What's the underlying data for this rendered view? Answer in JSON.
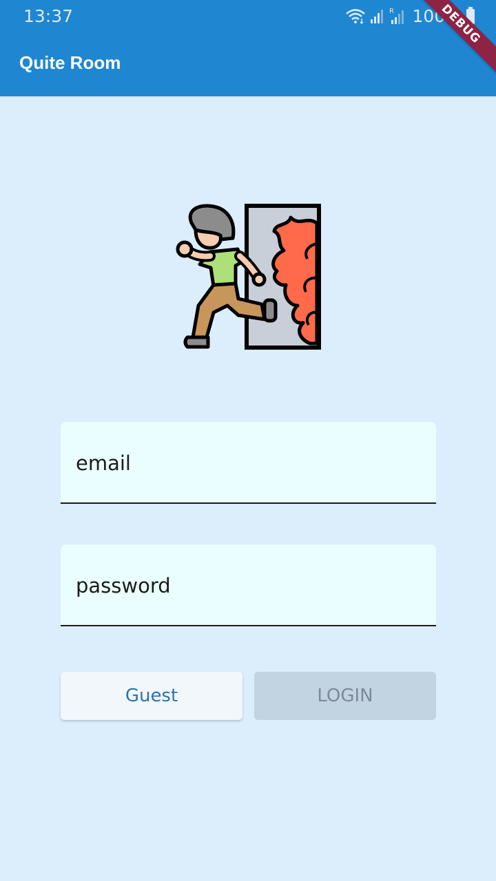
{
  "status_bar": {
    "time": "13:37",
    "battery": "100%",
    "icons": [
      "wifi-icon",
      "signal-icon",
      "signal-roaming-icon",
      "battery-icon"
    ]
  },
  "app_bar": {
    "title": "Quite Room",
    "debug_banner": "DEBUG"
  },
  "hero": {
    "icon": "running-from-fire-icon"
  },
  "form": {
    "email": {
      "placeholder": "email",
      "value": ""
    },
    "password": {
      "placeholder": "password",
      "value": ""
    }
  },
  "buttons": {
    "guest": "Guest",
    "login": "LOGIN"
  },
  "colors": {
    "primary": "#1f86d1",
    "background": "#dcedfc",
    "field_background": "#eafeff",
    "guest_text": "#2c73ad",
    "login_disabled_bg": "#c2d3e2",
    "fire": "#ff6b4a",
    "shirt": "#aee07a",
    "pants": "#c8955a"
  }
}
